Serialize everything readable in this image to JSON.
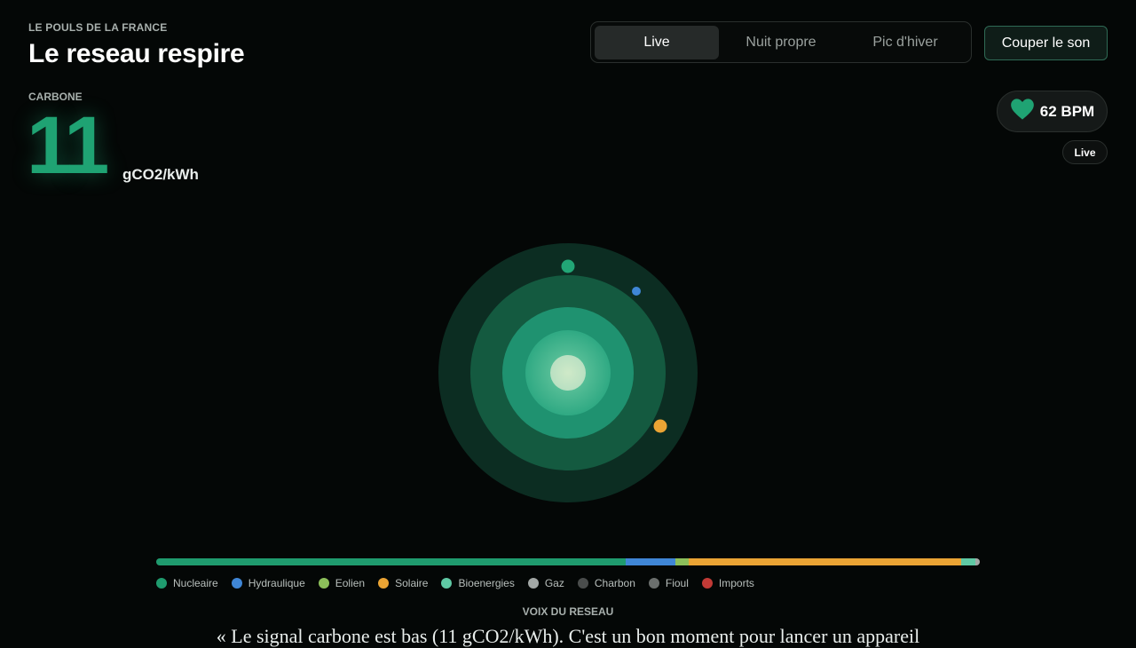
{
  "header": {
    "eyebrow": "LE POULS DE LA FRANCE",
    "title": "Le reseau respire"
  },
  "carbon": {
    "label": "CARBONE",
    "value": "11",
    "unit": "gCO2/kWh"
  },
  "modes": {
    "items": [
      {
        "label": "Live",
        "active": true
      },
      {
        "label": "Nuit propre",
        "active": false
      },
      {
        "label": "Pic d'hiver",
        "active": false
      }
    ]
  },
  "mute_button": {
    "label": "Couper le son"
  },
  "heart": {
    "bpm_text": "62 BPM",
    "icon": "heart-icon",
    "color": "#1fa373"
  },
  "live_badge": {
    "label": "Live"
  },
  "mix": {
    "note": "energy mix shares (fraction of total) as shown by the stacked bar",
    "segments": [
      {
        "source": "Nucleaire",
        "share": 0.57,
        "color": "#1f9b6e"
      },
      {
        "source": "Hydraulique",
        "share": 0.06,
        "color": "#3f86d6"
      },
      {
        "source": "Eolien",
        "share": 0.017,
        "color": "#8cbf5a"
      },
      {
        "source": "Solaire",
        "share": 0.33,
        "color": "#eba434"
      },
      {
        "source": "Bioenergies",
        "share": 0.018,
        "color": "#5fc9a4"
      },
      {
        "source": "Gaz",
        "share": 0.005,
        "color": "#a3a8a6"
      }
    ]
  },
  "legend": {
    "items": [
      {
        "label": "Nucleaire",
        "color": "#1f9b6e"
      },
      {
        "label": "Hydraulique",
        "color": "#3f86d6"
      },
      {
        "label": "Eolien",
        "color": "#8cbf5a"
      },
      {
        "label": "Solaire",
        "color": "#eba434"
      },
      {
        "label": "Bioenergies",
        "color": "#5fc9a4"
      },
      {
        "label": "Gaz",
        "color": "#a3a8a6"
      },
      {
        "label": "Charbon",
        "color": "#4a4d4c"
      },
      {
        "label": "Fioul",
        "color": "#6b6f6d"
      },
      {
        "label": "Imports",
        "color": "#c23a36"
      }
    ]
  },
  "voice": {
    "label": "VOIX DU RESEAU",
    "text": "« Le signal carbone est bas (11 gCO2/kWh). C'est un bon moment pour lancer un appareil"
  },
  "colors": {
    "accent": "#1fa373",
    "background": "#040706"
  }
}
